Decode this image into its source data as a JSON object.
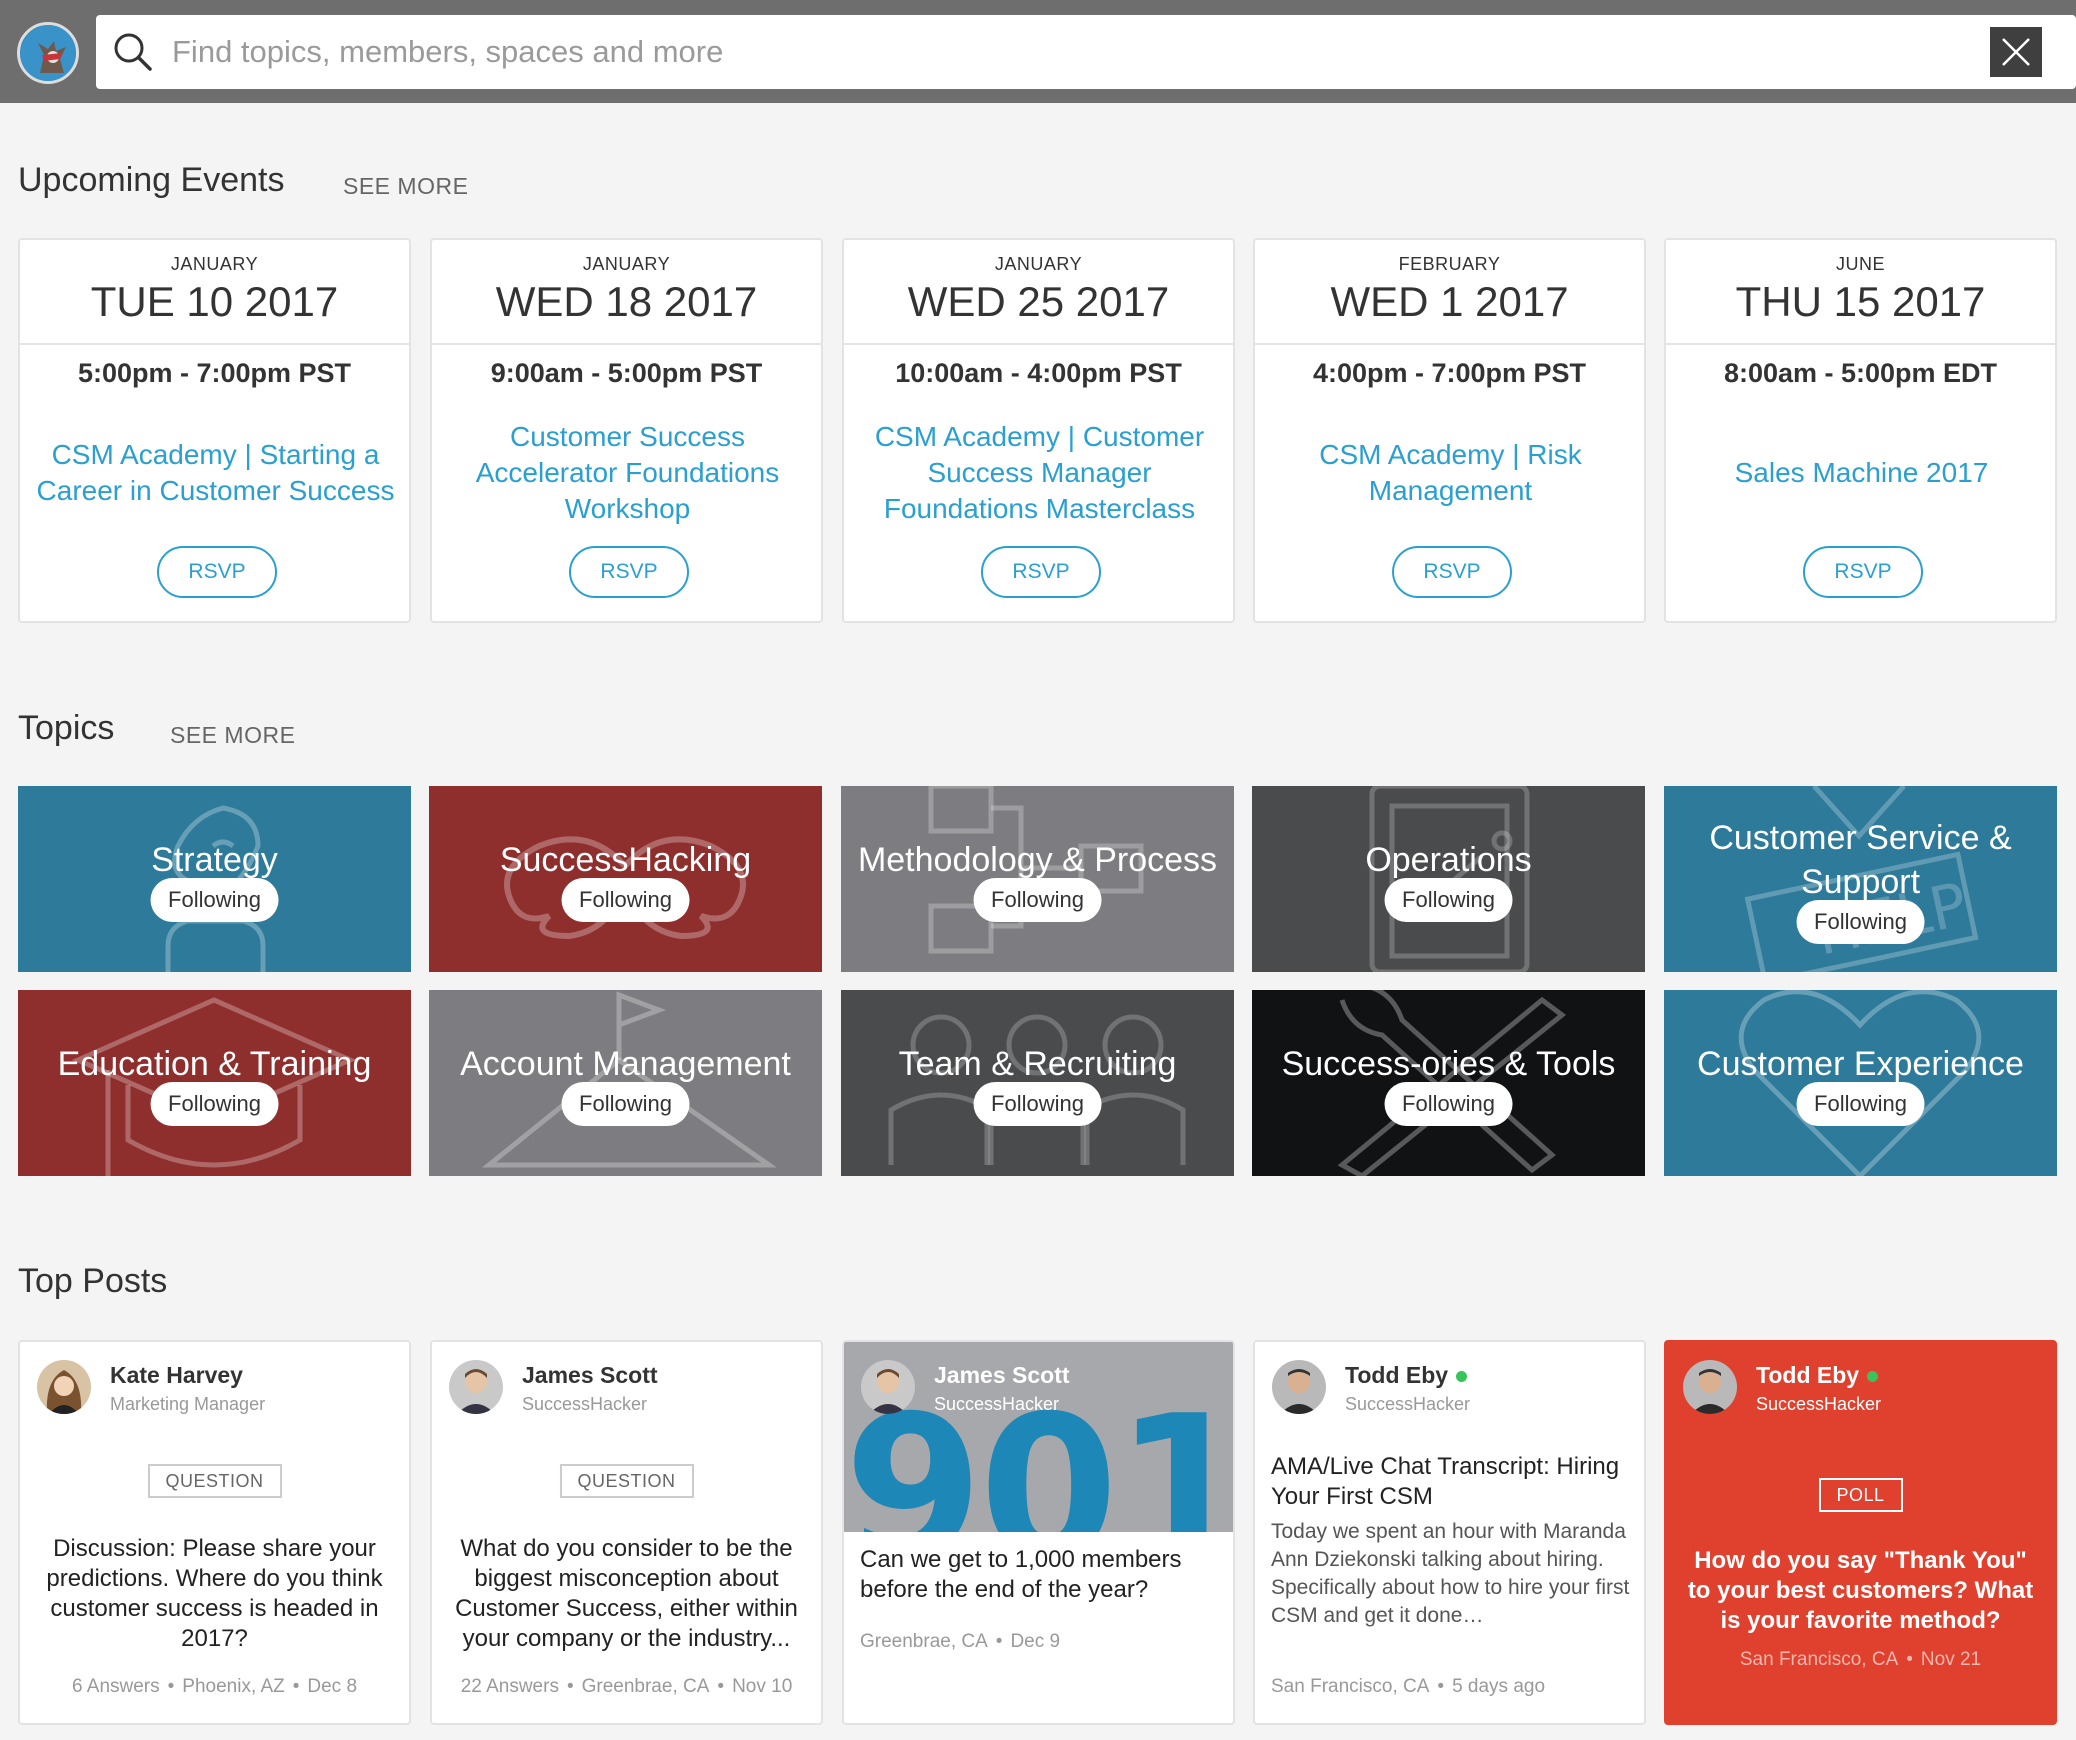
{
  "search": {
    "placeholder": "Find topics, members, spaces and more"
  },
  "events_section": {
    "title": "Upcoming Events",
    "see_more": "SEE MORE"
  },
  "events": [
    {
      "month": "JANUARY",
      "date": "TUE 10 2017",
      "time": "5:00pm - 7:00pm PST",
      "title": "CSM Academy | Starting a Career in Customer Success",
      "rsvp": "RSVP"
    },
    {
      "month": "JANUARY",
      "date": "WED 18 2017",
      "time": "9:00am - 5:00pm PST",
      "title": "Customer Success Accelerator Foundations Workshop",
      "rsvp": "RSVP"
    },
    {
      "month": "JANUARY",
      "date": "WED 25 2017",
      "time": "10:00am - 4:00pm PST",
      "title": "CSM Academy | Customer Success Manager Foundations Masterclass",
      "rsvp": "RSVP"
    },
    {
      "month": "FEBRUARY",
      "date": "WED 1 2017",
      "time": "4:00pm - 7:00pm PST",
      "title": "CSM Academy | Risk Management",
      "rsvp": "RSVP"
    },
    {
      "month": "JUNE",
      "date": "THU 15 2017",
      "time": "8:00am - 5:00pm EDT",
      "title": "Sales Machine 2017",
      "rsvp": "RSVP"
    }
  ],
  "topics_section": {
    "title": "Topics",
    "see_more": "SEE MORE"
  },
  "topics": [
    {
      "name": "Strategy",
      "follow": "Following",
      "color": "#2d7a9a",
      "icon": "chess-knight-icon"
    },
    {
      "name": "SuccessHacking",
      "follow": "Following",
      "color": "#8e2f2d",
      "icon": "mustache-icon"
    },
    {
      "name": "Methodology & Process",
      "follow": "Following",
      "color": "#7d7c80",
      "icon": "flowchart-icon"
    },
    {
      "name": "Operations",
      "follow": "Following",
      "color": "#4a4b4d",
      "icon": "clipboard-icon"
    },
    {
      "name": "Customer Service & Support",
      "follow": "Following",
      "color": "#2d7a9a",
      "icon": "help-sign-icon"
    },
    {
      "name": "Education & Training",
      "follow": "Following",
      "color": "#8e2f2d",
      "icon": "graduation-cap-icon"
    },
    {
      "name": "Account Management",
      "follow": "Following",
      "color": "#7d7c80",
      "icon": "mountain-flag-icon"
    },
    {
      "name": "Team & Recruiting",
      "follow": "Following",
      "color": "#4a4b4d",
      "icon": "team-icon"
    },
    {
      "name": "Success-ories & Tools",
      "follow": "Following",
      "color": "#111214",
      "icon": "wrench-screwdriver-icon"
    },
    {
      "name": "Customer Experience",
      "follow": "Following",
      "color": "#2d7a9a",
      "icon": "heart-icon"
    }
  ],
  "posts_section": {
    "title": "Top Posts"
  },
  "posts": [
    {
      "author": "Kate Harvey",
      "role": "Marketing Manager",
      "badge": "QUESTION",
      "text": "Discussion: Please share your predictions. Where do you think customer success is headed in 2017?",
      "answers": "6 Answers",
      "location": "Phoenix, AZ",
      "date": "Dec 8"
    },
    {
      "author": "James Scott",
      "role": "SuccessHacker",
      "badge": "QUESTION",
      "text": "What do you consider to be the biggest misconception about Customer Success, either within your company or the industry...",
      "answers": "22 Answers",
      "location": "Greenbrae, CA",
      "date": "Nov 10"
    },
    {
      "author": "James Scott",
      "role": "SuccessHacker",
      "image_text": "901",
      "text": "Can we get to 1,000 members before the end of the year?",
      "location": "Greenbrae, CA",
      "date": "Dec 9"
    },
    {
      "author": "Todd Eby",
      "role": "SuccessHacker",
      "title": "AMA/Live Chat Transcript: Hiring Your First CSM",
      "excerpt": "Today we spent an hour with Maranda Ann Dziekonski talking about hiring. Specifically about how to hire your first CSM and get it done…",
      "location": "San Francisco, CA",
      "date": "5 days ago"
    },
    {
      "author": "Todd Eby",
      "role": "SuccessHacker",
      "badge": "POLL",
      "text": "How do you say \"Thank You\" to your best customers? What is your favorite method?",
      "location": "San Francisco, CA",
      "date": "Nov 21",
      "color": "#e0402e"
    }
  ]
}
